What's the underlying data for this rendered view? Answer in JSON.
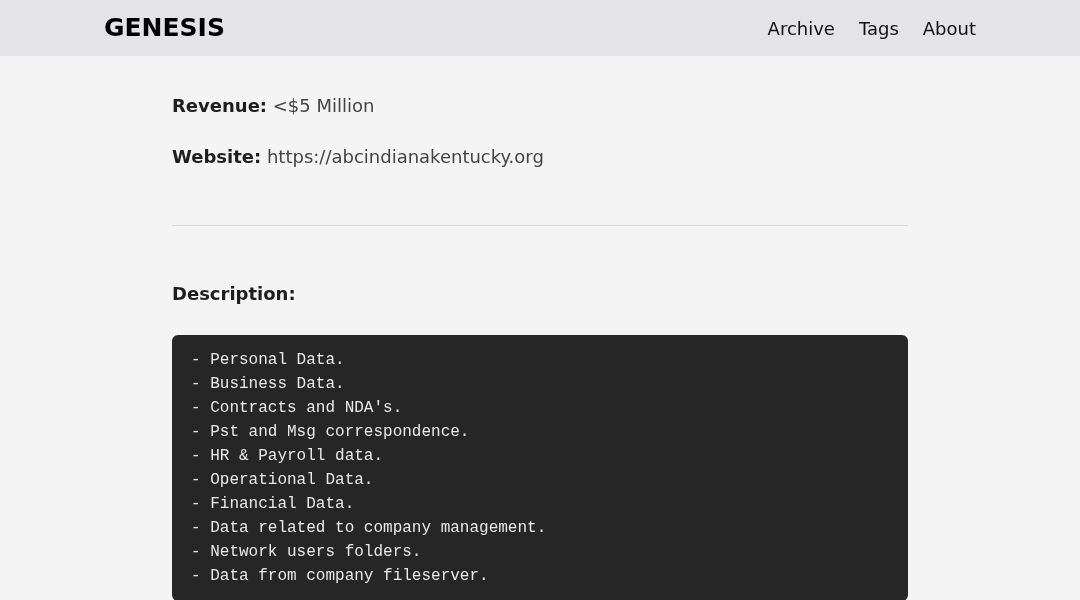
{
  "header": {
    "logo": "GENESIS",
    "nav": [
      "Archive",
      "Tags",
      "About"
    ]
  },
  "fields": [
    {
      "label": "Revenue:",
      "value": "<$5 Million"
    },
    {
      "label": "Website:",
      "value": "https://abcindianakentucky.org"
    }
  ],
  "description": {
    "heading": "Description:",
    "lines": [
      "- Personal Data.",
      "- Business Data.",
      "- Contracts and NDA's.",
      "- Pst and Msg correspondence.",
      "- HR & Payroll data.",
      "- Operational Data.",
      "- Financial Data.",
      "- Data related to company management.",
      "- Network users folders.",
      "- Data from company fileserver."
    ]
  }
}
